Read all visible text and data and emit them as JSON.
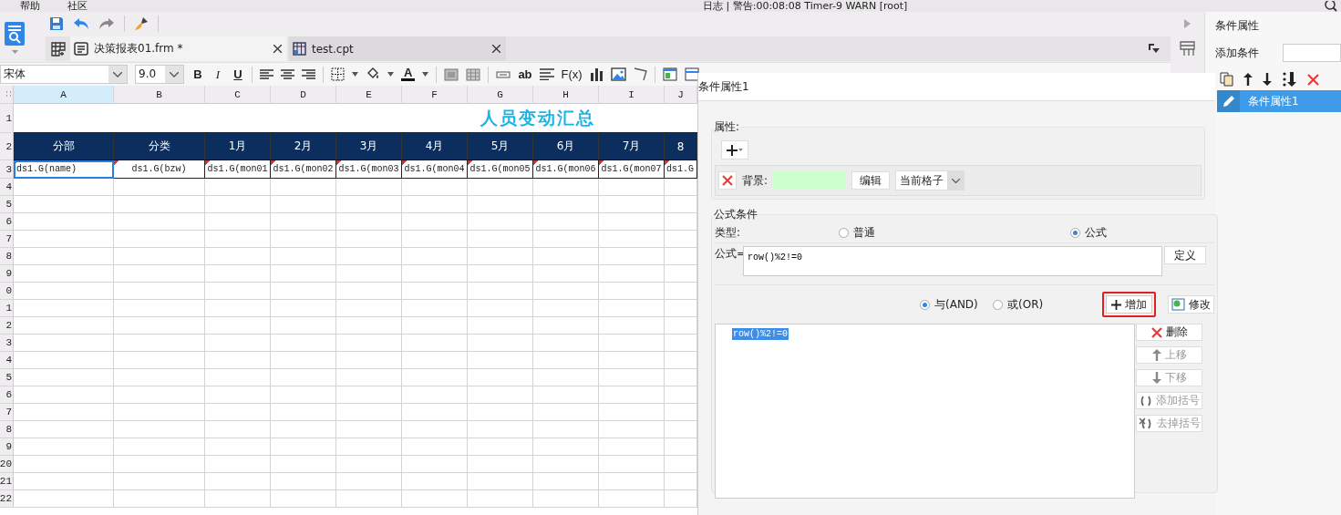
{
  "menu_bar": {
    "items": [
      "帮助",
      "社区"
    ],
    "status": "日志 | 警告:00:08:08 Timer-9 WARN [root]"
  },
  "tabs": [
    {
      "label": "决策报表01.frm *",
      "selected": true,
      "kind": "form"
    },
    {
      "label": "test.cpt",
      "selected": false,
      "kind": "report"
    }
  ],
  "format_toolbar": {
    "font": "宋体",
    "size": "9.0",
    "bold": "B",
    "italic": "I",
    "underline": "U",
    "font_color": "A",
    "text_style": "ab",
    "formula": "F(x)"
  },
  "sheet": {
    "columns": [
      {
        "label": "A",
        "selected": true
      },
      {
        "label": "B",
        "selected": false
      },
      {
        "label": "C",
        "selected": false
      },
      {
        "label": "D",
        "selected": false
      },
      {
        "label": "E",
        "selected": false
      },
      {
        "label": "F",
        "selected": false
      },
      {
        "label": "G",
        "selected": false
      },
      {
        "label": "H",
        "selected": false
      },
      {
        "label": "I",
        "selected": false
      },
      {
        "label": "J",
        "selected": false
      }
    ],
    "rows": [
      "1",
      "2",
      "3",
      "4",
      "5",
      "6",
      "7",
      "8",
      "9",
      "0",
      "1",
      "2",
      "3",
      "4",
      "5",
      "6",
      "7",
      "8",
      "9",
      "20",
      "21",
      "22"
    ],
    "title": "人员变动汇总",
    "header": [
      "分部",
      "分类",
      "1月",
      "2月",
      "3月",
      "4月",
      "5月",
      "6月",
      "7月",
      "8"
    ],
    "data": [
      {
        "text": "ds1.G(name)",
        "selected": true
      },
      {
        "text": "ds1.G(bzw)",
        "selected": false
      },
      {
        "text": "ds1.G(mon01",
        "selected": false
      },
      {
        "text": "ds1.G(mon02",
        "selected": false
      },
      {
        "text": "ds1.G(mon03",
        "selected": false
      },
      {
        "text": "ds1.G(mon04",
        "selected": false
      },
      {
        "text": "ds1.G(mon05",
        "selected": false
      },
      {
        "text": "ds1.G(mon06",
        "selected": false
      },
      {
        "text": "ds1.G(mon07",
        "selected": false
      },
      {
        "text": "ds1.G",
        "selected": false
      }
    ]
  },
  "dialog": {
    "title": "条件属性1",
    "properties": {
      "legend": "属性:",
      "label": "背景:",
      "color": "#ccffcc",
      "edit": "编辑",
      "scope": "当前格子"
    },
    "formula_condition": {
      "legend": "公式条件",
      "type_label": "类型:",
      "types": [
        {
          "label": "普通",
          "selected": false
        },
        {
          "label": "公式",
          "selected": true
        }
      ],
      "formula_label": "公式=",
      "formula": "row()%2!=0",
      "define": "定义",
      "joins": [
        {
          "label": "与(AND)",
          "selected": true
        },
        {
          "label": "或(OR)",
          "selected": false
        }
      ],
      "add": "增加",
      "modify": "修改",
      "conditions": [
        {
          "text": "row()%2!=0",
          "selected": true
        }
      ],
      "actions": [
        {
          "label": "删除",
          "kind": "delete",
          "disabled": false
        },
        {
          "label": "上移",
          "kind": "up",
          "disabled": true
        },
        {
          "label": "下移",
          "kind": "down",
          "disabled": true
        },
        {
          "label": "添加括号",
          "kind": "add_bracket",
          "disabled": true
        },
        {
          "label": "去掉括号",
          "kind": "remove_bracket",
          "disabled": true
        }
      ]
    }
  },
  "side_panel": {
    "title": "条件属性",
    "add_label": "添加条件",
    "items": [
      {
        "label": "条件属性1",
        "selected": true
      }
    ]
  }
}
